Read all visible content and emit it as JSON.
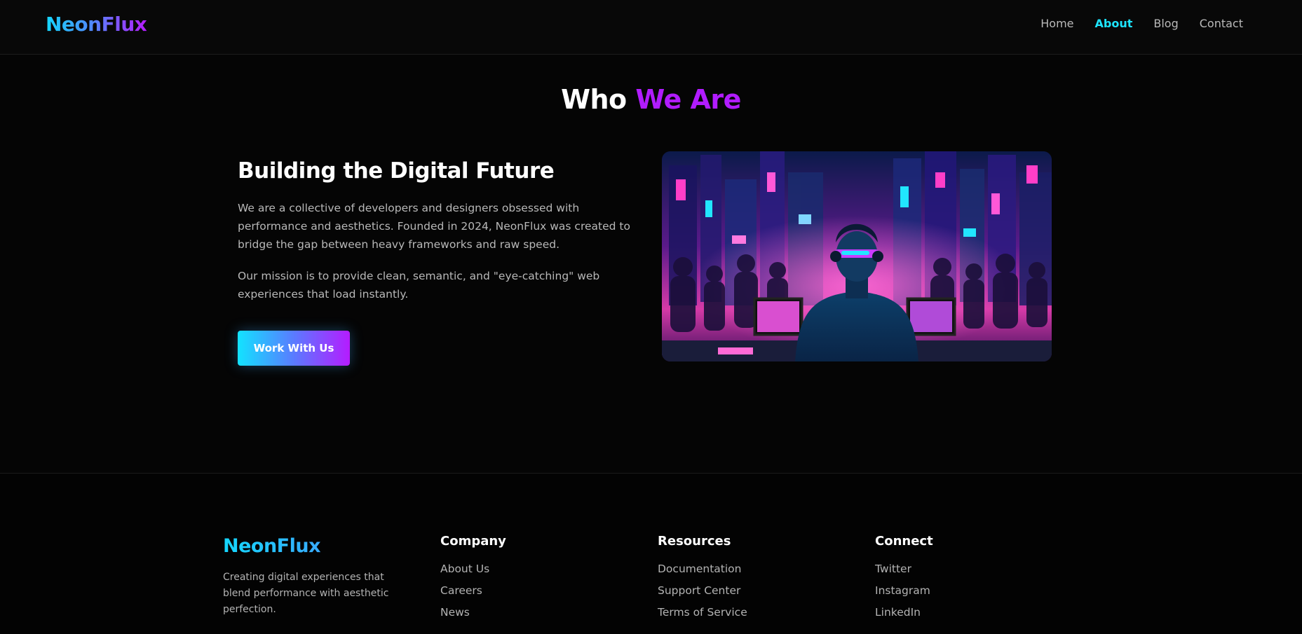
{
  "header": {
    "logo": "NeonFlux",
    "nav": [
      {
        "label": "Home",
        "active": false
      },
      {
        "label": "About",
        "active": true
      },
      {
        "label": "Blog",
        "active": false
      },
      {
        "label": "Contact",
        "active": false
      }
    ]
  },
  "about": {
    "title_main": "Who",
    "title_accent": "We Are",
    "heading": "Building the Digital Future",
    "paragraphs": [
      "We are a collective of developers and designers obsessed with performance and aesthetics. Founded in 2024, NeonFlux was created to bridge the gap between heavy frameworks and raw speed.",
      "Our mission is to provide clean, semantic, and \"eye-catching\" web experiences that load instantly."
    ],
    "cta_label": "Work With Us",
    "image_icon": "cyberpunk-city-illustration"
  },
  "footer": {
    "logo": "NeonFlux",
    "tagline": "Creating digital experiences that blend performance with aesthetic perfection.",
    "columns": [
      {
        "heading": "Company",
        "links": [
          "About Us",
          "Careers",
          "News"
        ]
      },
      {
        "heading": "Resources",
        "links": [
          "Documentation",
          "Support Center",
          "Terms of Service"
        ]
      },
      {
        "heading": "Connect",
        "links": [
          "Twitter",
          "Instagram",
          "LinkedIn"
        ]
      }
    ]
  },
  "colors": {
    "background": "#050505",
    "accent_cyan": "#1de4ff",
    "accent_purple": "#b11cff",
    "text_muted": "#b8b8b8"
  }
}
